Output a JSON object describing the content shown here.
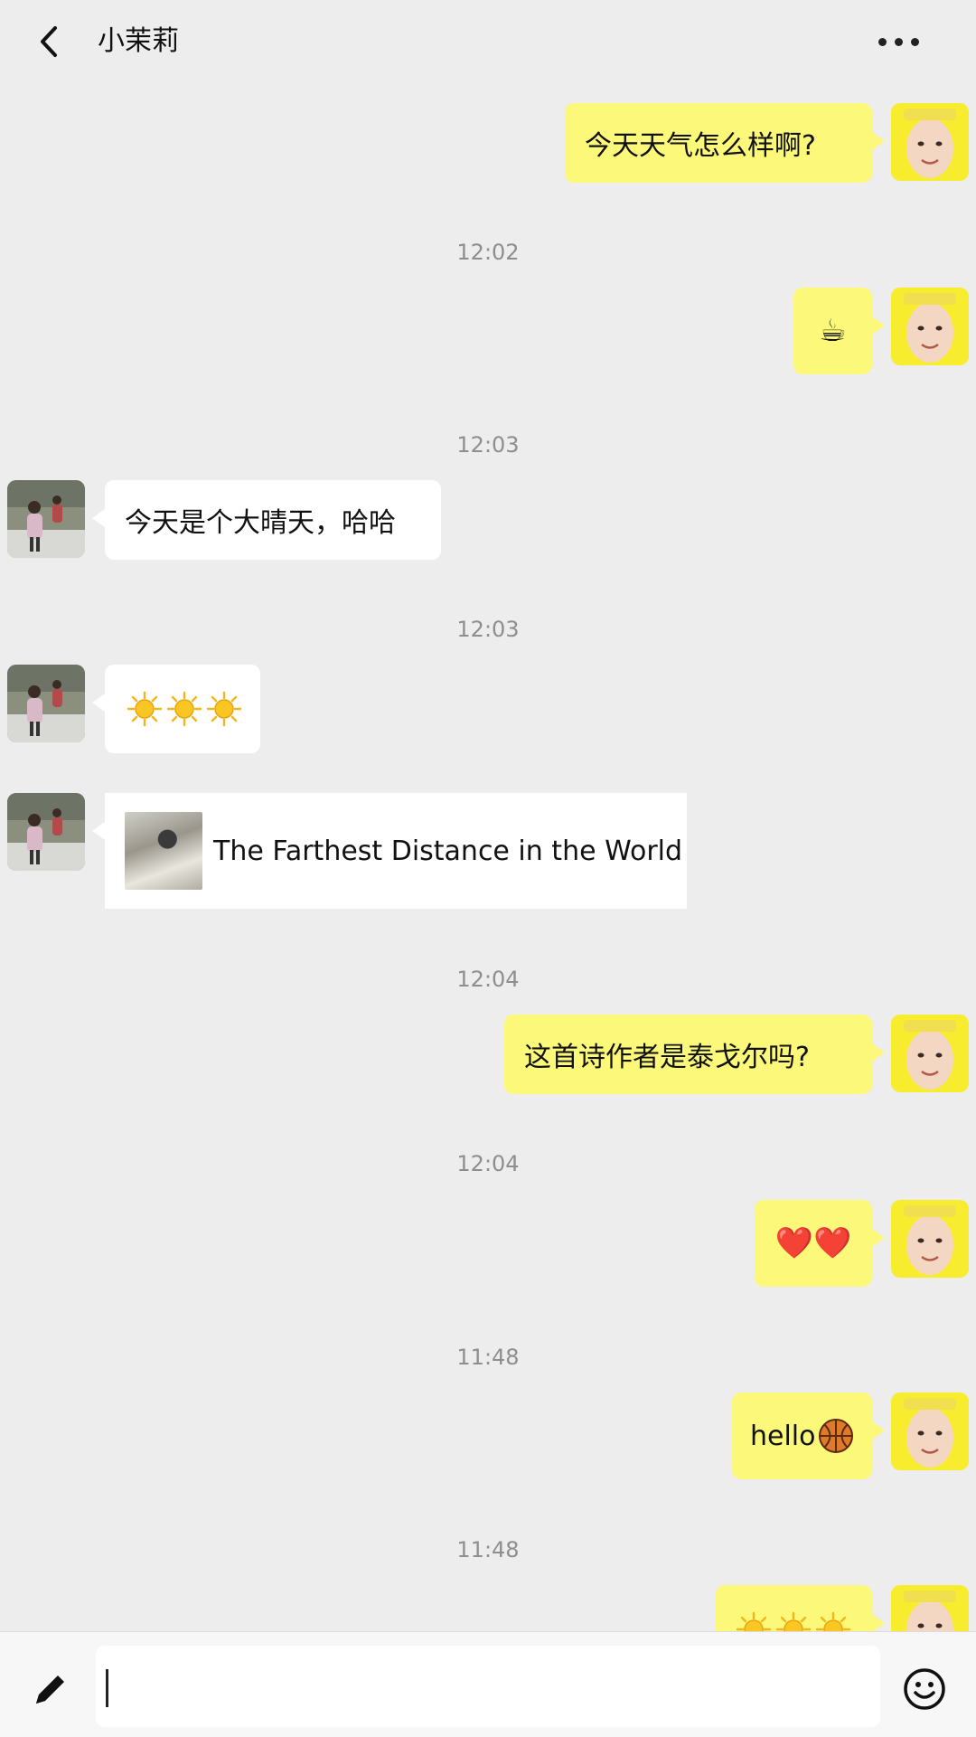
{
  "header": {
    "title": "小茉莉",
    "back_icon": "chevron-left-icon",
    "more_icon": "more-dots-icon"
  },
  "messages": [
    {
      "from": "me",
      "type": "text",
      "text": "今天天气怎么样啊?"
    },
    {
      "type": "time",
      "text": "12:02"
    },
    {
      "from": "me",
      "type": "emoji",
      "emoji": "coffee-icon",
      "text": "☕"
    },
    {
      "type": "time",
      "text": "12:03"
    },
    {
      "from": "other",
      "type": "text",
      "text": "今天是个大晴天，哈哈"
    },
    {
      "type": "time",
      "text": "12:03"
    },
    {
      "from": "other",
      "type": "emoji",
      "emoji": "sun-icon",
      "count": 3
    },
    {
      "from": "other",
      "type": "link",
      "title": "The Farthest Distance in the World"
    },
    {
      "type": "time",
      "text": "12:04"
    },
    {
      "from": "me",
      "type": "text",
      "text": "这首诗作者是泰戈尔吗?"
    },
    {
      "type": "time",
      "text": "12:04"
    },
    {
      "from": "me",
      "type": "emoji",
      "emoji": "heart-icon",
      "text": "❤️❤️"
    },
    {
      "type": "time",
      "text": "11:48"
    },
    {
      "from": "me",
      "type": "text",
      "text": "hello",
      "emoji": "basketball-icon"
    },
    {
      "type": "time",
      "text": "11:48"
    },
    {
      "from": "me",
      "type": "emoji",
      "emoji": "sun-icon",
      "count": 3
    }
  ],
  "composer": {
    "value": "",
    "left_icon": "pencil-icon",
    "right_icon": "emoji-smile-icon"
  },
  "colors": {
    "background": "#ededed",
    "my_bubble": "#fcf97a",
    "other_bubble": "#ffffff",
    "timestamp": "#8e8e8e"
  }
}
